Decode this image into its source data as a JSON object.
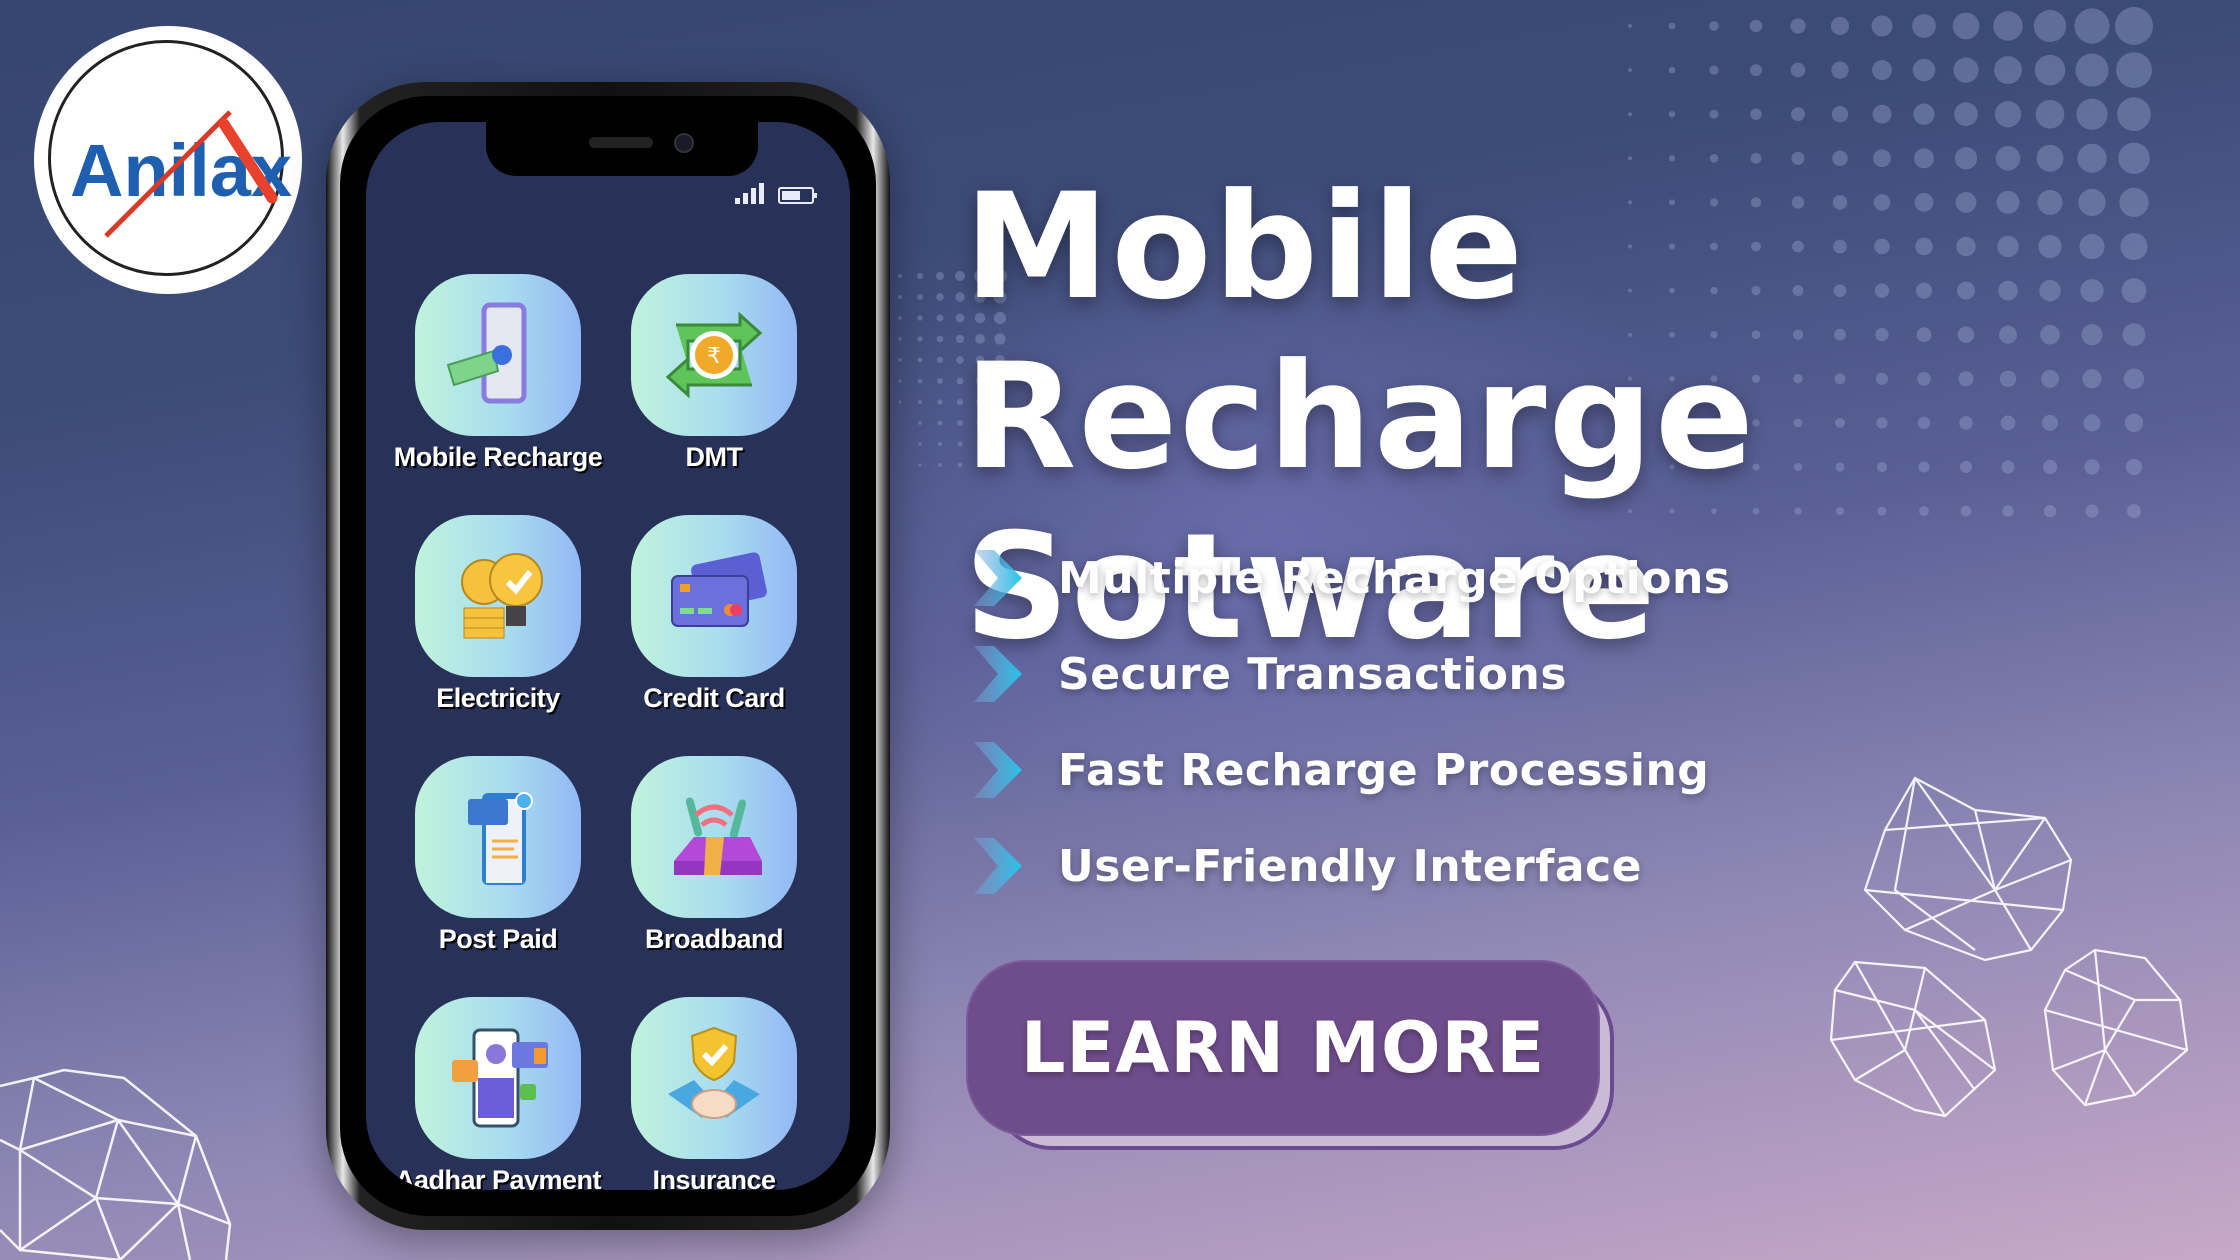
{
  "brand": {
    "logo_text": "Anilax",
    "logo_colors": {
      "blue": "#1f5fb0",
      "red": "#e8412c",
      "orange": "#f47a34"
    }
  },
  "phone": {
    "status_bar": {
      "signal_bars": 4,
      "battery_level": 0.75
    },
    "apps": [
      {
        "label": "Mobile Recharge",
        "icon": "phone-cash-icon"
      },
      {
        "label": "DMT",
        "icon": "rupee-transfer-icon"
      },
      {
        "label": "Electricity",
        "icon": "bulb-coins-icon"
      },
      {
        "label": "Credit Card",
        "icon": "credit-card-icon"
      },
      {
        "label": "Post Paid",
        "icon": "bill-receipt-icon"
      },
      {
        "label": "Broadband",
        "icon": "wifi-router-icon"
      },
      {
        "label": "Aadhar Payment",
        "icon": "fingerprint-login-icon"
      },
      {
        "label": "Insurance",
        "icon": "shield-handshake-icon"
      }
    ]
  },
  "headline": {
    "line1": "Mobile Recharge",
    "line2": "Sotware"
  },
  "features": [
    "Multiple Recharge Options",
    "Secure Transactions",
    "Fast Recharge Processing",
    "User-Friendly Interface"
  ],
  "cta": {
    "label": "LEARN MORE"
  },
  "colors": {
    "cta_bg": "#6f4c8b",
    "screen_bg": "#283259",
    "chevron": "#2ec4e6"
  }
}
